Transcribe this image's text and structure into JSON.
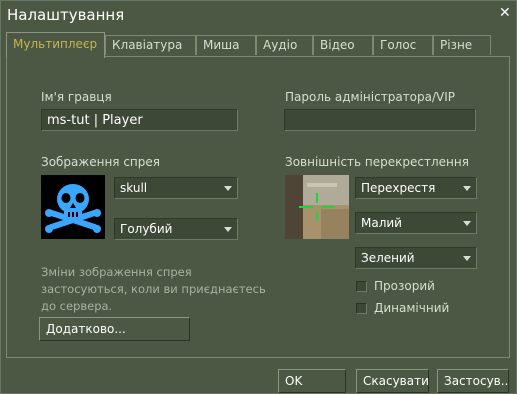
{
  "window": {
    "title": "Налаштування"
  },
  "tabs": [
    "Мультиплеєр",
    "Клавіатура",
    "Миша",
    "Аудіо",
    "Відео",
    "Голос",
    "Різне"
  ],
  "player_name": {
    "label": "Ім'я гравця",
    "value": "ms-tut | Player"
  },
  "admin_password": {
    "label": "Пароль адміністратора/VIP",
    "value": ""
  },
  "spray": {
    "label": "Зображення спрея",
    "image_select": "skull",
    "color_select": "Голубий",
    "hint": "Зміни зображення спрея застосуються, коли ви приєднаєтесь до сервера."
  },
  "crosshair": {
    "label": "Зовнішність перекрестлення",
    "style_select": "Перехрестя",
    "size_select": "Малий",
    "color_select": "Зелений",
    "transparent_label": "Прозорий",
    "dynamic_label": "Динамічний"
  },
  "advanced_button": "Додатково...",
  "footer": {
    "ok": "OK",
    "cancel": "Скасувати",
    "apply": "Застосув..."
  },
  "colors": {
    "bg": "#4c5844",
    "active_tab_text": "#c4b550",
    "crosshair": "#28d040",
    "spray_icon": "#3aa6ff"
  }
}
